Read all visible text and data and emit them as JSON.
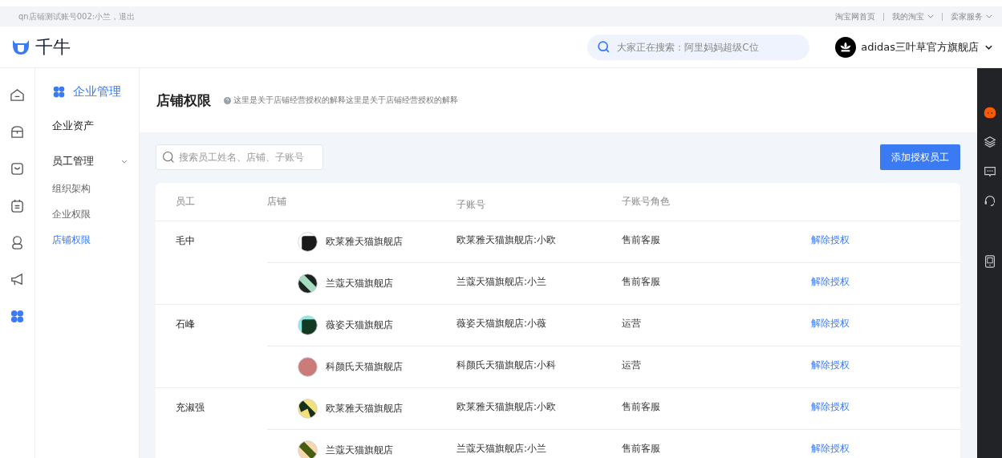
{
  "top_bar": {
    "account_text": "qn店铺测试账号002:小兰，退出",
    "links": [
      {
        "label": "淘宝网首页",
        "has_caret": false
      },
      {
        "label": "我的淘宝",
        "has_caret": true
      },
      {
        "label": "卖家服务",
        "has_caret": true
      }
    ]
  },
  "header": {
    "brand": "千牛",
    "search": {
      "placeholder": "大家正在搜索：阿里妈妈超级C位"
    },
    "shop_name": "adidas三叶草官方旗舰店"
  },
  "sidebar": {
    "title": "企业管理",
    "items": [
      {
        "label": "企业资产",
        "kind": "item",
        "selected": false
      },
      {
        "label": "员工管理",
        "kind": "group",
        "expanded": true,
        "selected": false,
        "children": [
          {
            "label": "组织架构",
            "selected": false
          },
          {
            "label": "企业权限",
            "selected": false
          },
          {
            "label": "店铺权限",
            "selected": true
          }
        ]
      }
    ]
  },
  "page": {
    "title": "店铺权限",
    "hint": "这里是关于店铺经营授权的解释这里是关于店铺经营授权的解释",
    "search": {
      "placeholder": "搜索员工姓名、店铺、子账号"
    },
    "add_button": "添加授权员工"
  },
  "table": {
    "columns": [
      "员工",
      "店铺",
      "子账号",
      "子账号角色"
    ],
    "employees": [
      {
        "name": "毛中",
        "stores": [
          {
            "store": "欧莱雅天猫旗舰店",
            "account": "欧莱雅天猫旗舰店:小欧",
            "role": "售前客服",
            "action": "解除授权"
          },
          {
            "store": "兰蔻天猫旗舰店",
            "account": "兰蔻天猫旗舰店:小兰",
            "role": "售前客服",
            "action": "解除授权"
          }
        ]
      },
      {
        "name": "石峰",
        "stores": [
          {
            "store": "薇姿天猫旗舰店",
            "account": "薇姿天猫旗舰店:小薇",
            "role": "运营",
            "action": "解除授权"
          },
          {
            "store": "科颜氏天猫旗舰店",
            "account": "科颜氏天猫旗舰店:小科",
            "role": "运营",
            "action": "解除授权"
          }
        ]
      },
      {
        "name": "充淑强",
        "stores": [
          {
            "store": "欧莱雅天猫旗舰店",
            "account": "欧莱雅天猫旗舰店:小欧",
            "role": "售前客服",
            "action": "解除授权"
          },
          {
            "store": "兰蔻天猫旗舰店",
            "account": "兰蔻天猫旗舰店:小兰",
            "role": "售前客服",
            "action": "解除授权"
          }
        ]
      }
    ]
  }
}
